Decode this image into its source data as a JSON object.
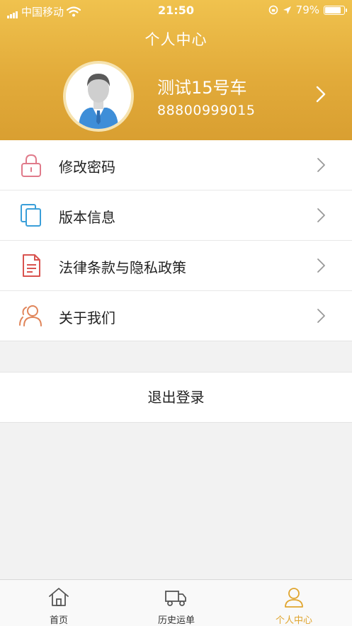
{
  "status_bar": {
    "carrier": "中国移动",
    "time": "21:50",
    "battery": "79%",
    "battery_level": 0.79
  },
  "header": {
    "title": "个人中心",
    "user_name": "测试15号车",
    "user_phone": "88800999015"
  },
  "menu": [
    {
      "label": "修改密码",
      "icon": "lock-icon",
      "color": "#e07a8a"
    },
    {
      "label": "版本信息",
      "icon": "copy-icon",
      "color": "#3a9fd9"
    },
    {
      "label": "法律条款与隐私政策",
      "icon": "document-icon",
      "color": "#d9534f"
    },
    {
      "label": "关于我们",
      "icon": "users-icon",
      "color": "#e0855a"
    }
  ],
  "logout_label": "退出登录",
  "tabs": [
    {
      "label": "首页",
      "icon": "home-icon"
    },
    {
      "label": "历史运单",
      "icon": "truck-icon"
    },
    {
      "label": "个人中心",
      "icon": "person-icon",
      "active": true
    }
  ],
  "colors": {
    "header": "#e2ab3a",
    "active_tab": "#e0a52f"
  }
}
